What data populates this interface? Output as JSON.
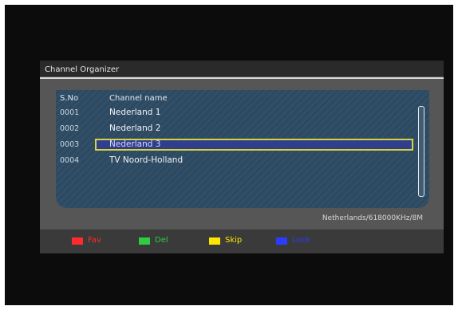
{
  "panel": {
    "title": "Channel Organizer"
  },
  "list": {
    "columns": {
      "sno": "S.No",
      "name": "Channel name"
    },
    "rows": [
      {
        "sno": "0001",
        "name": "Nederland 1"
      },
      {
        "sno": "0002",
        "name": "Nederland 2"
      },
      {
        "sno": "0003",
        "name": "Nederland 3"
      },
      {
        "sno": "0004",
        "name": "TV Noord-Holland"
      }
    ],
    "selected_index": 2
  },
  "frequency_info": "Netherlands/618000KHz/8M",
  "color_keys": [
    {
      "label": "Fav",
      "color": "#ff2b2b"
    },
    {
      "label": "Del",
      "color": "#2ecc40"
    },
    {
      "label": "Skip",
      "color": "#ffe600"
    },
    {
      "label": "Lock",
      "color": "#2b3bff"
    }
  ]
}
